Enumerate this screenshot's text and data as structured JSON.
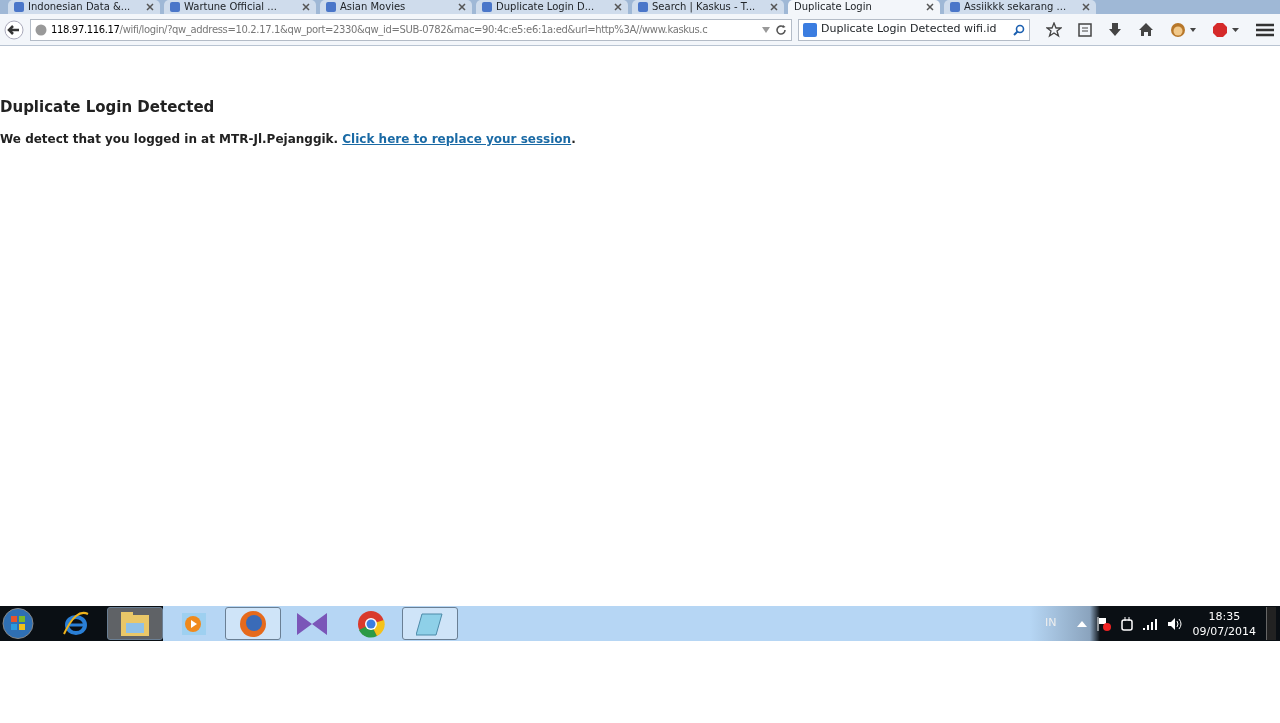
{
  "tabs": [
    {
      "label": "Indonesian Data &...",
      "selected": false
    },
    {
      "label": "Wartune Official ...",
      "selected": false
    },
    {
      "label": "Asian Movies",
      "selected": false
    },
    {
      "label": "Duplicate Login D...",
      "selected": false
    },
    {
      "label": "Search | Kaskus - T...",
      "selected": false
    },
    {
      "label": "Duplicate Login",
      "selected": true
    },
    {
      "label": "Assiikkk sekarang ...",
      "selected": false
    }
  ],
  "address_bar": {
    "host": "118.97.116.17",
    "path": "/wifi/login/?qw_address=10.2.17.1&qw_port=2330&qw_id=SUB-0782&mac=90:4c:e5:e6:1a:ed&url=http%3A//www.kaskus.c"
  },
  "search_field": {
    "value": "Duplicate Login Detected wifi.id"
  },
  "page": {
    "heading": "Duplicate Login Detected",
    "message": "We detect that you logged in at MTR-Jl.Pejanggik.",
    "link": "Click here to replace your session",
    "after_link": "."
  },
  "taskbar": {
    "apps": [
      {
        "kind": "ie",
        "active": false
      },
      {
        "kind": "folder",
        "active": true
      },
      {
        "kind": "media",
        "active": false
      },
      {
        "kind": "firefox",
        "active": true
      },
      {
        "kind": "bowtie",
        "active": false
      },
      {
        "kind": "chrome",
        "active": false
      },
      {
        "kind": "notepad",
        "active": true
      }
    ],
    "language": "IN",
    "time": "18:35",
    "date": "09/07/2014"
  }
}
